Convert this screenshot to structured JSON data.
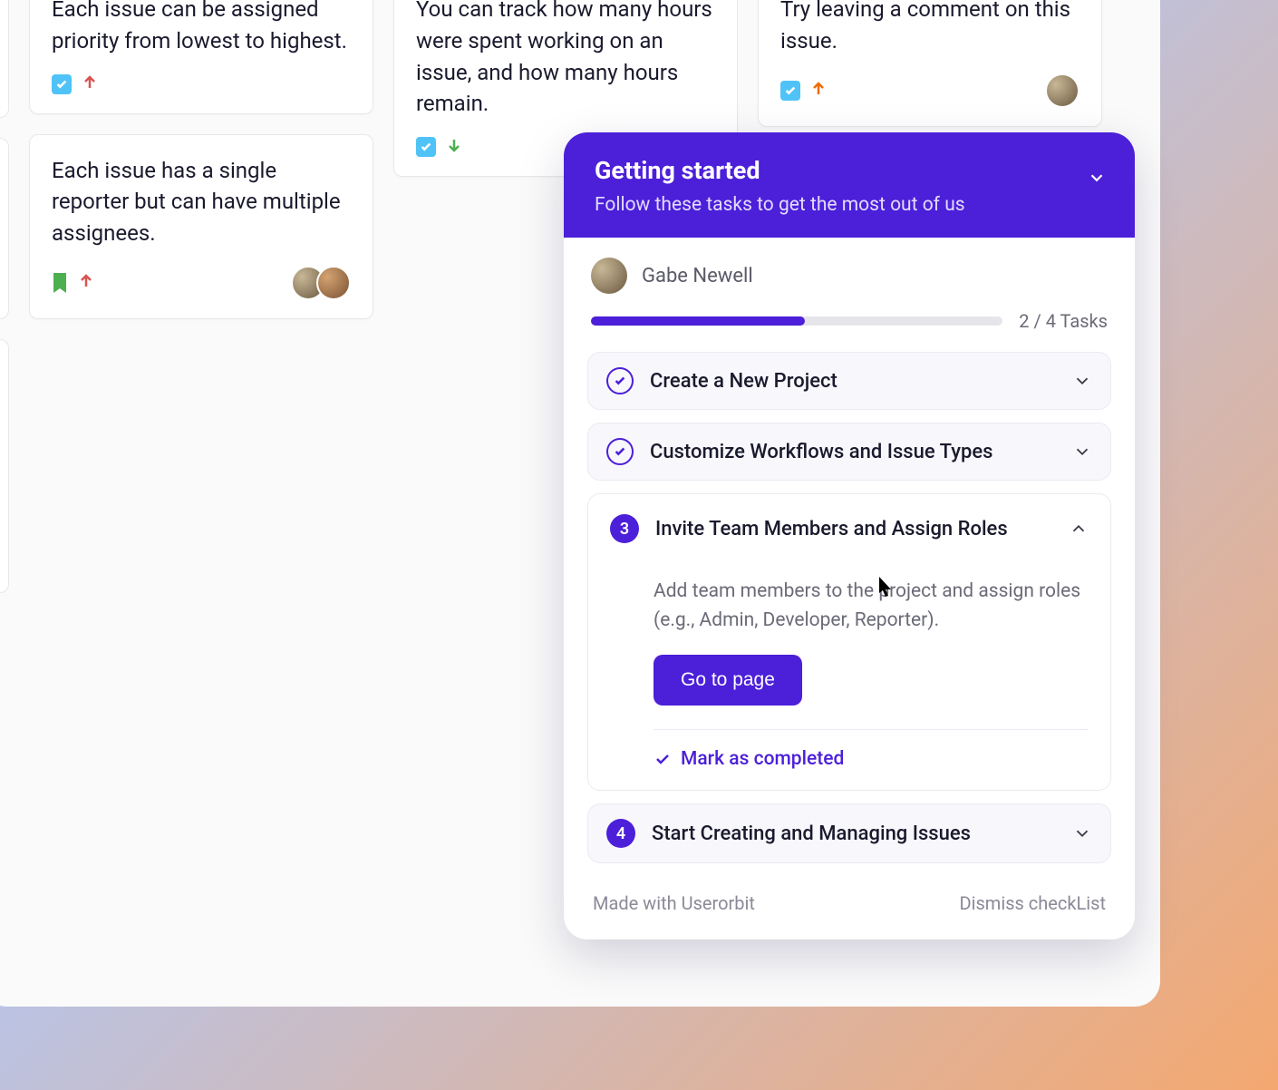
{
  "cards": {
    "priority": {
      "text": "Each issue can be assigned priority from lowest to highest."
    },
    "reporter": {
      "text": "Each issue has a single reporter but can have multiple assignees."
    },
    "hours": {
      "text": "You can track how many hours were spent working on an issue, and how many hours remain."
    },
    "comment": {
      "text": "Try leaving a comment on this issue."
    }
  },
  "gs": {
    "title": "Getting started",
    "subtitle": "Follow these tasks to get the most out of us",
    "user": "Gabe Newell",
    "progress_label": "2 / 4 Tasks",
    "progress_pct": 52,
    "tasks": [
      {
        "label": "Create a New Project",
        "done": true
      },
      {
        "label": "Customize Workflows and Issue Types",
        "done": true
      },
      {
        "label": "Invite Team Members and Assign Roles",
        "num": "3",
        "desc": "Add team members to the project and assign roles (e.g., Admin, Developer, Reporter).",
        "cta": "Go to page",
        "mark": "Mark as completed"
      },
      {
        "label": "Start Creating and Managing Issues",
        "num": "4"
      }
    ],
    "footer_made": "Made with Userorbit",
    "footer_dismiss": "Dismiss checkList"
  }
}
